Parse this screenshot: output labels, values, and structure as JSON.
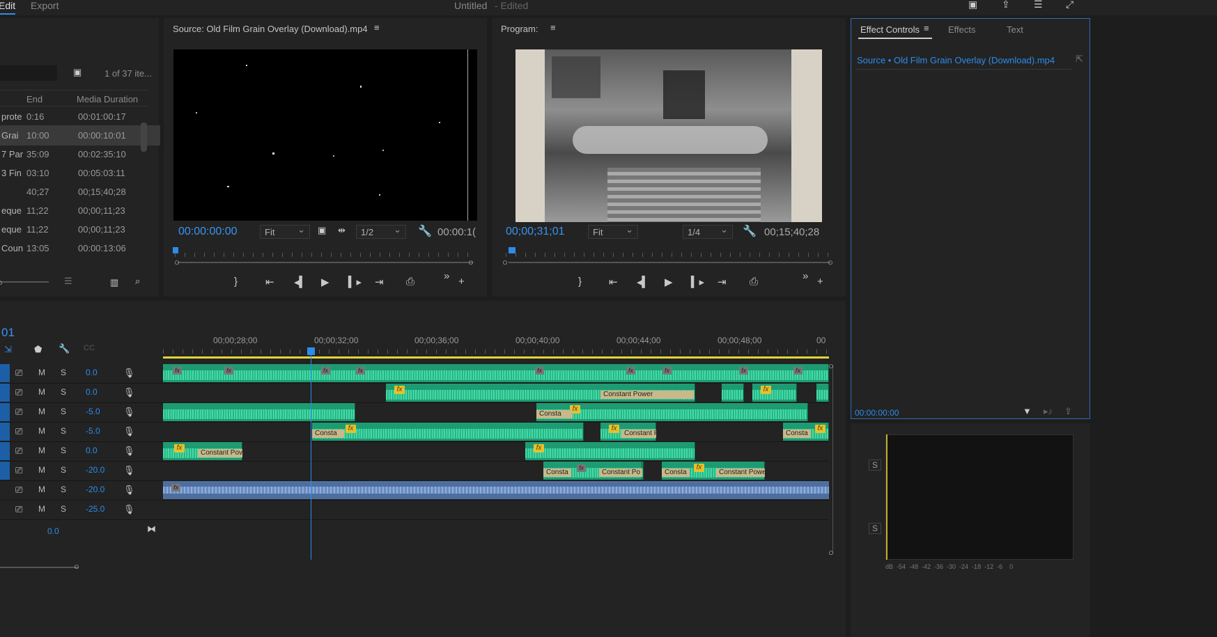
{
  "topbar": {
    "edit": "Edit",
    "export": "Export",
    "title": "Untitled",
    "edited": "- Edited"
  },
  "project": {
    "count": "1 of 37 ite...",
    "col_end": "End",
    "col_duration": "Media Duration",
    "rows": [
      {
        "name": "prote",
        "end": "0:16",
        "dur": "00:01:00:17"
      },
      {
        "name": "Grai",
        "end": "10:00",
        "dur": "00:00:10:01"
      },
      {
        "name": "7 Par",
        "end": "35:09",
        "dur": "00:02:35:10"
      },
      {
        "name": "3 Fin",
        "end": "03:10",
        "dur": "00:05:03:11"
      },
      {
        "name": "",
        "end": "40;27",
        "dur": "00;15;40;28"
      },
      {
        "name": "eque",
        "end": "11;22",
        "dur": "00;00;11;23"
      },
      {
        "name": "eque",
        "end": "11;22",
        "dur": "00;00;11;23"
      },
      {
        "name": "Coun",
        "end": "13:05",
        "dur": "00:00:13:06"
      }
    ]
  },
  "source": {
    "title": "Source: Old Film Grain   Overlay (Download).mp4",
    "timecode": "00:00:00:00",
    "fit": "Fit",
    "res": "1/2",
    "dur": "00:00:1("
  },
  "program": {
    "title": "Program:",
    "timecode": "00;00;31;01",
    "fit": "Fit",
    "res": "1/4",
    "dur": "00;15;40;28"
  },
  "effect_controls": {
    "tab1": "Effect Controls",
    "tab2": "Effects",
    "tab3": "Text",
    "source_line": "Source • Old Film Grain   Overlay (Download).mp4",
    "timecode": "00:00:00:00"
  },
  "timeline": {
    "seq_tc": "01",
    "ruler_labels": [
      "00;00;28;00",
      "00;00;32;00",
      "00;00;36;00",
      "00;00;40;00",
      "00;00;44;00",
      "00;00;48;00",
      "00"
    ],
    "tracks": [
      {
        "m": "M",
        "s": "S",
        "vol": "0.0"
      },
      {
        "m": "M",
        "s": "S",
        "vol": "0.0"
      },
      {
        "m": "M",
        "s": "S",
        "vol": "-5.0"
      },
      {
        "m": "M",
        "s": "S",
        "vol": "-5.0"
      },
      {
        "m": "M",
        "s": "S",
        "vol": "0.0"
      },
      {
        "m": "M",
        "s": "S",
        "vol": "-20.0"
      },
      {
        "m": "M",
        "s": "S",
        "vol": "-20.0"
      },
      {
        "m": "M",
        "s": "S",
        "vol": "-25.0"
      }
    ],
    "master_vol": "0.0",
    "trans_constant_power": "Constant Power",
    "trans_consta": "Consta",
    "trans_constant_pov": "Constant Pov",
    "trans_constant_po": "Constant Po",
    "trans_constant_pow": "Constant Powe",
    "trans_constant_p": "Constant P"
  },
  "meter": {
    "s1": "S",
    "s2": "S",
    "scale": "dB  -54  -48  -42  -36  -30  -24  -18  -12  -6    0"
  },
  "fx_label": "fx"
}
